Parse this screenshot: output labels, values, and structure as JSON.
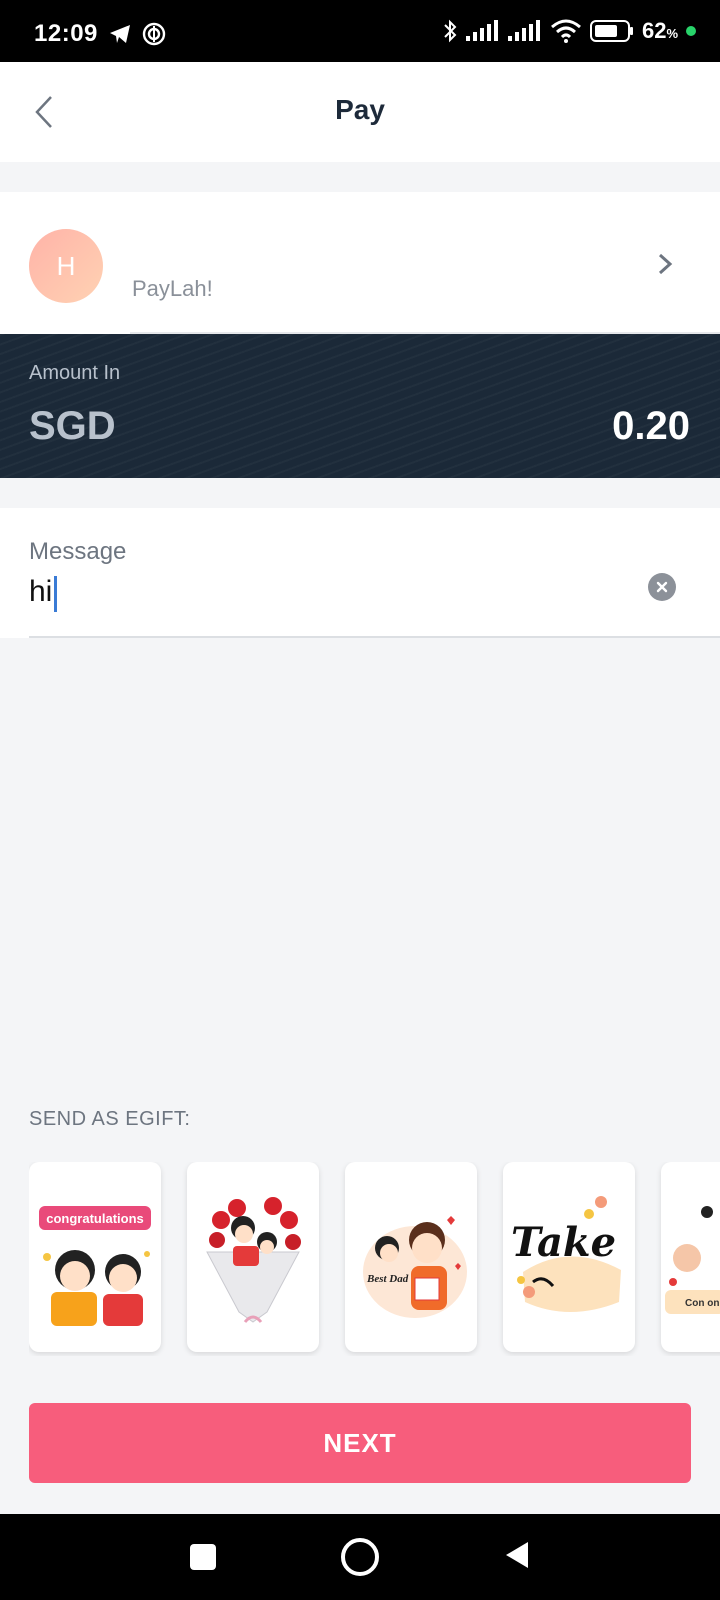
{
  "status": {
    "time": "12:09",
    "battery": "62",
    "battery_unit": "%"
  },
  "header": {
    "title": "Pay",
    "back_icon": "chevron-left-icon"
  },
  "recipient": {
    "avatar_initial": "H",
    "subtitle": "PayLah!",
    "chevron_icon": "chevron-right-icon"
  },
  "amount": {
    "label": "Amount In",
    "currency": "SGD",
    "value": "0.20"
  },
  "message": {
    "label": "Message",
    "value": "hi",
    "clear_icon": "clear-icon"
  },
  "egift": {
    "label": "SEND AS EGIFT:",
    "cards": [
      {
        "name": "congratulations-card",
        "caption": "congratulations"
      },
      {
        "name": "flower-bouquet-card",
        "caption": ""
      },
      {
        "name": "best-dad-card",
        "caption": "Best Dad"
      },
      {
        "name": "take-care-card",
        "caption": "Take"
      },
      {
        "name": "congrats-on-card",
        "caption": "Con on"
      }
    ]
  },
  "actions": {
    "next_label": "NEXT"
  },
  "colors": {
    "primary": "#f75d7c",
    "amount_bg": "#1b2938",
    "background": "#f4f5f7"
  }
}
